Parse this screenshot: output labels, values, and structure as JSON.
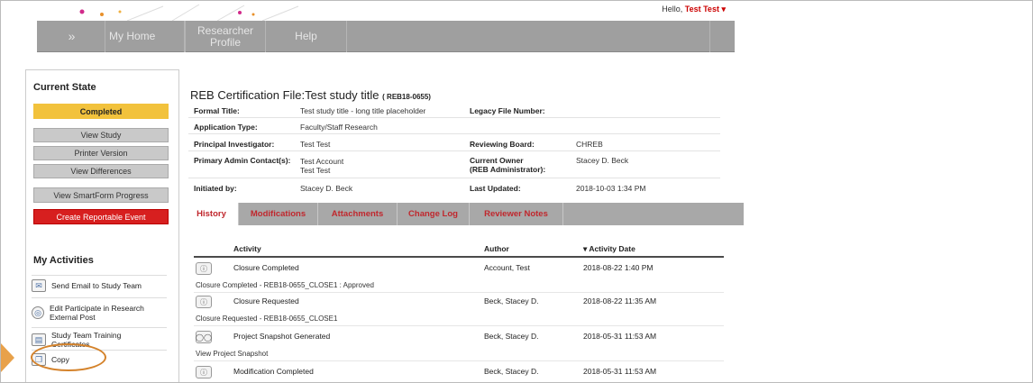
{
  "header": {
    "greeting": "Hello,",
    "user_name": "Test Test",
    "user_caret": "▾"
  },
  "nav": {
    "expand": "»",
    "items": [
      "My Home",
      "Researcher Profile",
      "Help"
    ]
  },
  "left": {
    "current_state_title": "Current State",
    "state": "Completed",
    "buttons": [
      "View Study",
      "Printer Version",
      "View Differences",
      "View SmartForm Progress"
    ],
    "reportable": "Create Reportable Event",
    "activities_title": "My Activities",
    "activities": [
      {
        "label": "Send Email to Study Team",
        "icon": "email-icon"
      },
      {
        "label": "Edit Participate in Research External Post",
        "icon": "web-icon"
      },
      {
        "label": "Study Team Training Certificates",
        "icon": "certificate-icon"
      },
      {
        "label": "Copy",
        "icon": "copy-icon"
      }
    ]
  },
  "file": {
    "title": "REB Certification File:Test study title",
    "code": "( REB18-0655)",
    "formal_title_label": "Formal Title:",
    "formal_title": "Test study title - long title placeholder",
    "legacy_label": "Legacy File Number:",
    "legacy": "",
    "app_type_label": "Application Type:",
    "app_type": "Faculty/Staff Research",
    "pi_label": "Principal Investigator:",
    "pi": "Test Test",
    "board_label": "Reviewing Board:",
    "board": "CHREB",
    "admin_label": "Primary Admin Contact(s):",
    "admin_1": "Test Account",
    "admin_2": "Test Test",
    "owner_label_1": "Current Owner",
    "owner_label_2": "(REB Administrator):",
    "owner": "Stacey D. Beck",
    "initiated_label": "Initiated by:",
    "initiated": "Stacey D. Beck",
    "updated_label": "Last Updated:",
    "updated": "2018-10-03 1:34 PM"
  },
  "tabs": [
    "History",
    "Modifications",
    "Attachments",
    "Change Log",
    "Reviewer Notes"
  ],
  "history": {
    "columns": {
      "activity": "Activity",
      "author": "Author",
      "date": "▾ Activity Date"
    },
    "rows": [
      {
        "activity": "Closure Completed",
        "author": "Account, Test",
        "date": "2018-08-22 1:40 PM",
        "note": "Closure Completed - REB18-0655_CLOSE1 : Approved"
      },
      {
        "activity": "Closure Requested",
        "author": "Beck, Stacey D.",
        "date": "2018-08-22 11:35 AM",
        "note": "Closure Requested - REB18-0655_CLOSE1"
      },
      {
        "activity": "Project Snapshot Generated",
        "author": "Beck, Stacey D.",
        "date": "2018-05-31 11:53 AM",
        "note": "View Project Snapshot"
      },
      {
        "activity": "Modification Completed",
        "author": "Beck, Stacey D.",
        "date": "2018-05-31 11:53 AM",
        "note": ""
      }
    ]
  },
  "colors": {
    "accent_red": "#c0272d",
    "state_yellow": "#f2c23c",
    "nav_gray": "#9f9f9f"
  }
}
